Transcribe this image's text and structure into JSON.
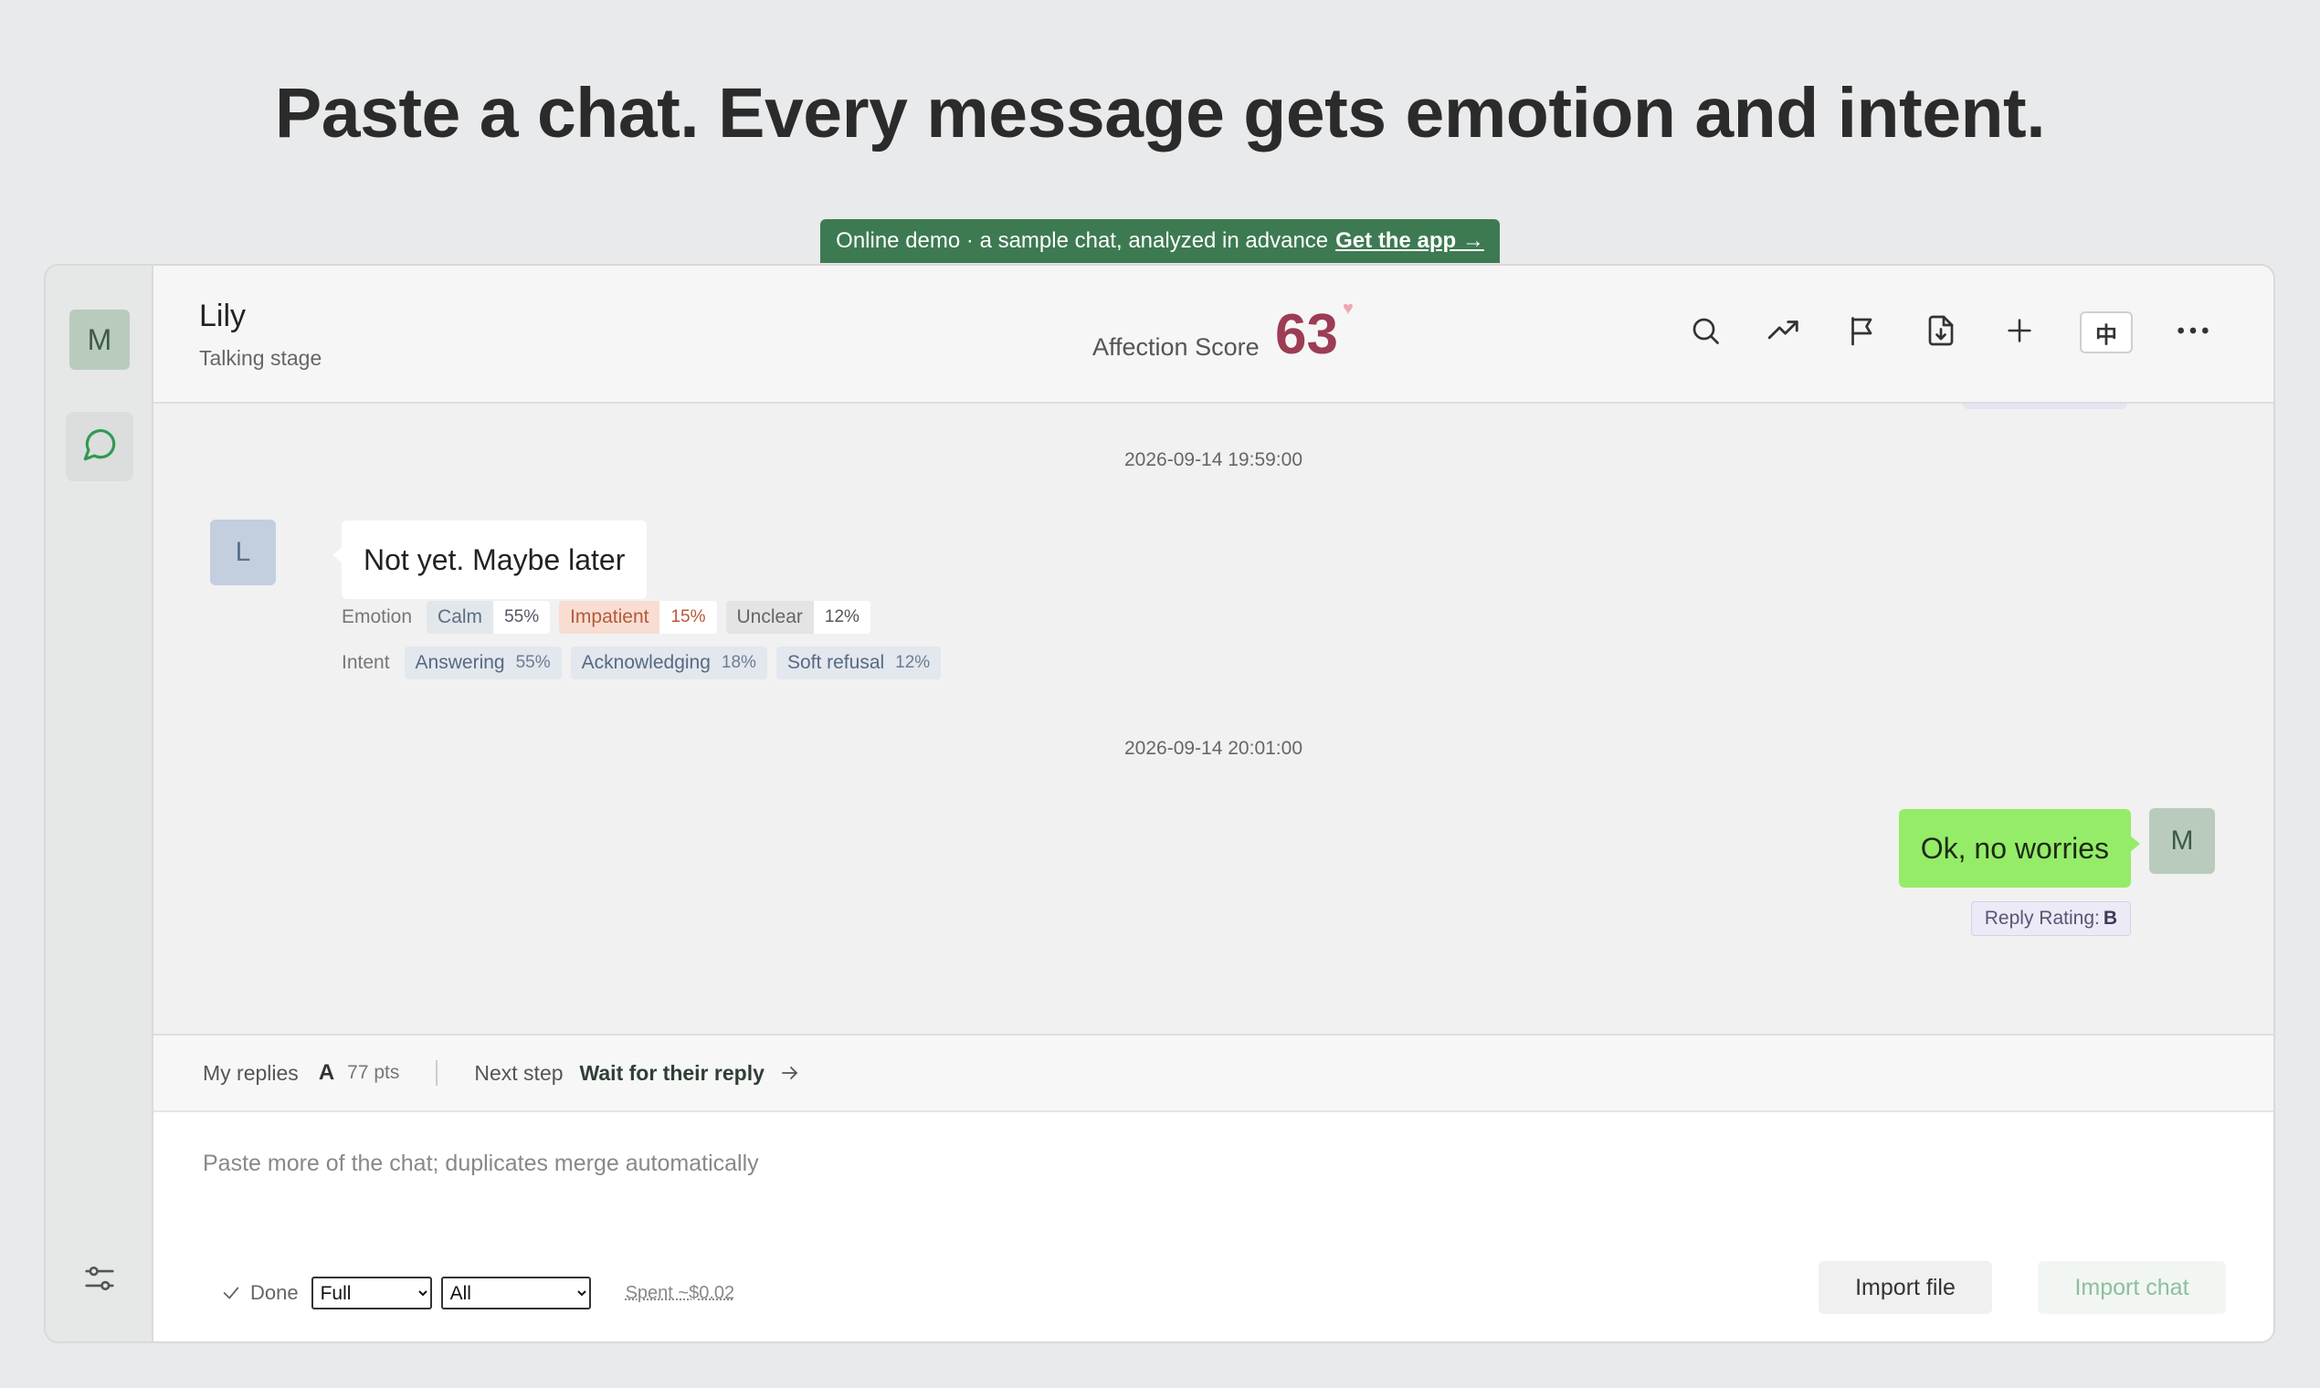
{
  "headline": "Paste a chat. Every message gets emotion and intent.",
  "banner": {
    "text": "Online demo · a sample chat, analyzed in advance",
    "link": "Get the app →"
  },
  "sidebar": {
    "avatar_letter": "M",
    "chat_icon": "chat-bubble-icon",
    "settings_icon": "sliders-icon"
  },
  "header": {
    "contact_name": "Lily",
    "contact_status": "Talking stage",
    "affection_label": "Affection Score",
    "affection_score": "63",
    "heart": "♥",
    "icons": [
      "search-icon",
      "trend-icon",
      "flag-icon",
      "export-icon",
      "plus-icon",
      "language-icon",
      "more-icon"
    ],
    "lang_label": "中"
  },
  "messages": [
    {
      "timestamp": "2026-09-14 19:59:00",
      "sender": "L",
      "direction": "in",
      "text": "Not yet. Maybe later",
      "emotion_label": "Emotion",
      "emotions": [
        {
          "name": "Calm",
          "pct": "55%"
        },
        {
          "name": "Impatient",
          "pct": "15%"
        },
        {
          "name": "Unclear",
          "pct": "12%"
        }
      ],
      "intent_label": "Intent",
      "intents": [
        {
          "name": "Answering",
          "pct": "55%"
        },
        {
          "name": "Acknowledging",
          "pct": "18%"
        },
        {
          "name": "Soft refusal",
          "pct": "12%"
        }
      ]
    },
    {
      "timestamp": "2026-09-14 20:01:00",
      "sender": "M",
      "direction": "out",
      "text": "Ok, no worries",
      "rating_label": "Reply Rating:",
      "rating": "B"
    }
  ],
  "status": {
    "my_replies_label": "My replies",
    "my_replies_grade": "A",
    "my_replies_pts": "77 pts",
    "next_step_label": "Next step",
    "next_step_value": "Wait for their reply"
  },
  "composer": {
    "placeholder": "Paste more of the chat; duplicates merge automatically",
    "done_label": "Done",
    "mode_selected": "Full",
    "scope_selected": "All",
    "spent": "Spent ~$0.02",
    "import_file": "Import file",
    "import_chat": "Import chat"
  },
  "colors": {
    "accent_green": "#3d7a52",
    "bubble_out": "#95ec69",
    "affection": "#9c3c55",
    "impatient": "#b55a3a"
  }
}
